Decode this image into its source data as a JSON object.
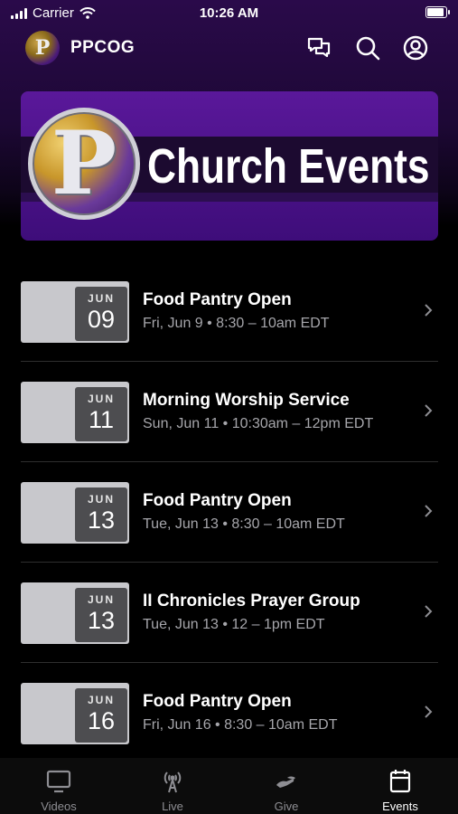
{
  "status_bar": {
    "carrier": "Carrier",
    "time": "10:26 AM"
  },
  "header": {
    "app_name": "PPCOG",
    "logo_letter": "P"
  },
  "banner": {
    "logo_letter": "P",
    "title": "Church Events"
  },
  "events": [
    {
      "month": "JUN",
      "day": "09",
      "title": "Food Pantry Open",
      "subtitle": "Fri, Jun 9 • 8:30 – 10am EDT"
    },
    {
      "month": "JUN",
      "day": "11",
      "title": "Morning Worship Service",
      "subtitle": "Sun, Jun 11 • 10:30am – 12pm EDT"
    },
    {
      "month": "JUN",
      "day": "13",
      "title": "Food Pantry Open",
      "subtitle": "Tue, Jun 13 • 8:30 – 10am EDT"
    },
    {
      "month": "JUN",
      "day": "13",
      "title": "II Chronicles Prayer Group",
      "subtitle": "Tue, Jun 13 • 12 – 1pm EDT"
    },
    {
      "month": "JUN",
      "day": "16",
      "title": "Food Pantry Open",
      "subtitle": "Fri, Jun 16 • 8:30 – 10am EDT"
    }
  ],
  "tabs": [
    {
      "label": "Videos",
      "icon": "tv-icon",
      "active": false
    },
    {
      "label": "Live",
      "icon": "broadcast-icon",
      "active": false
    },
    {
      "label": "Give",
      "icon": "give-hand-icon",
      "active": false
    },
    {
      "label": "Events",
      "icon": "calendar-icon",
      "active": true
    }
  ],
  "colors": {
    "accent": "#5a189a",
    "background": "#000000",
    "date_tile": "#c8c8cc",
    "date_box": "#4d4d50"
  }
}
